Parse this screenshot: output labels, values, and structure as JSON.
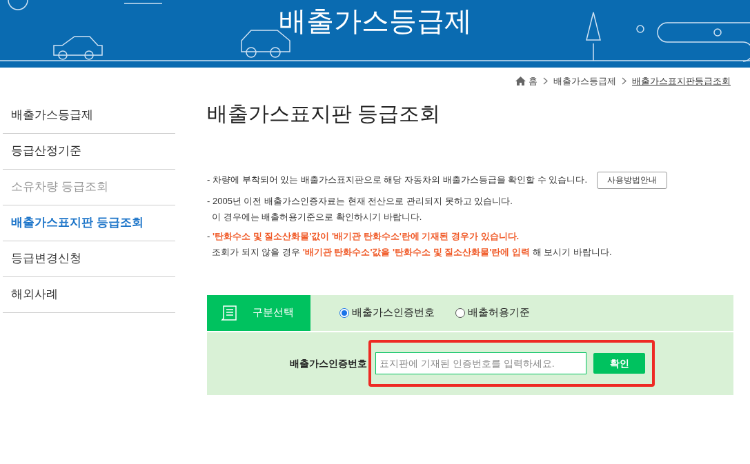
{
  "banner": {
    "title": "배출가스등급제"
  },
  "breadcrumb": [
    {
      "label": "홈",
      "kind": "home"
    },
    {
      "label": "배출가스등급제",
      "kind": "plain"
    },
    {
      "label": "배출가스표지판등급조회",
      "kind": "current"
    }
  ],
  "sidebar": {
    "items": [
      {
        "label": "배출가스등급제",
        "selected": false,
        "disabled": false
      },
      {
        "label": "등급산정기준",
        "selected": false,
        "disabled": false
      },
      {
        "label": "소유차량 등급조회",
        "selected": false,
        "disabled": true
      },
      {
        "label": "배출가스표지판 등급조회",
        "selected": true,
        "disabled": false
      },
      {
        "label": "등급변경신청",
        "selected": false,
        "disabled": false
      },
      {
        "label": "해외사례",
        "selected": false,
        "disabled": false
      }
    ]
  },
  "page_title": "배출가스표지판 등급조회",
  "notes": [
    {
      "lines": [
        [
          {
            "text": "- 차량에 부착되어 있는 배출가스표지판으로 해당 자동차의 배출가스등급을 확인할 수 있습니다.",
            "highlight": false
          }
        ]
      ],
      "button": "사용방법안내"
    },
    {
      "lines": [
        [
          {
            "text": "- 2005년 이전 배출가스인증자료는 현재 전산으로 관리되지 못하고 있습니다.",
            "highlight": false
          }
        ],
        [
          {
            "text": "  이 경우에는 배출허용기준으로 확인하시기 바랍니다.",
            "highlight": false
          }
        ]
      ]
    },
    {
      "lines": [
        [
          {
            "text": "- ",
            "highlight": false
          },
          {
            "text": "'탄화수소 및 질소산화물'값이 '배기관 탄화수소'란에 기재된 경우가 있습니다.",
            "highlight": true
          }
        ],
        [
          {
            "text": "  조회가 되지 않을 경우 ",
            "highlight": false
          },
          {
            "text": "'배기관 탄화수소'값을 '탄화수소 및 질소산화물'란에 입력",
            "highlight": true
          },
          {
            "text": " 해 보시기 바랍니다.",
            "highlight": false
          }
        ]
      ]
    }
  ],
  "search_form": {
    "section_label": "구분선택",
    "options": [
      {
        "label": "배출가스인증번호",
        "selected": true
      },
      {
        "label": "배출허용기준",
        "selected": false
      }
    ],
    "field_label": "배출가스인증번호",
    "placeholder": "표지판에 기재된 인증번호를 입력하세요.",
    "submit": "확인"
  }
}
